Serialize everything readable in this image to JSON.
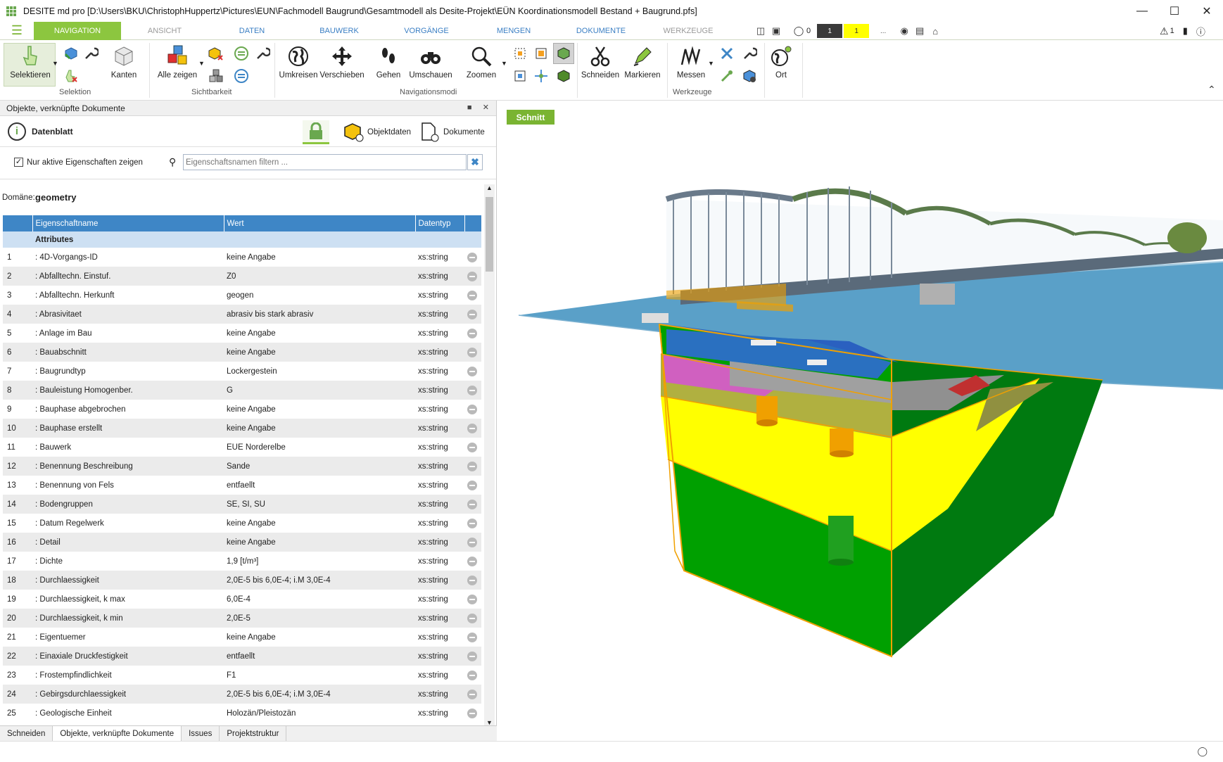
{
  "window": {
    "title": "DESITE md pro [D:\\Users\\BKU\\ChristophHuppertz\\Pictures\\EUN\\Fachmodell Baugrund\\Gesamtmodell als Desite-Projekt\\EÜN Koordinationsmodell Bestand + Baugrund.pfs]"
  },
  "menu": {
    "tabs": [
      "NAVIGATION",
      "ANSICHT",
      "DATEN",
      "BAUWERK",
      "VORGÄNGE",
      "MENGEN",
      "DOKUMENTE",
      "WERKZEUGE"
    ],
    "counter_a": "0",
    "counter_b": "1",
    "counter_c": "1",
    "ellipsis": "...",
    "warning_count": "1"
  },
  "ribbon": {
    "selektieren": "Selektieren",
    "kanten": "Kanten",
    "alle_zeigen": "Alle zeigen",
    "umkreisen": "Umkreisen",
    "verschieben": "Verschieben",
    "gehen": "Gehen",
    "umschauen": "Umschauen",
    "zoomen": "Zoomen",
    "schneiden": "Schneiden",
    "markieren": "Markieren",
    "messen": "Messen",
    "ort": "Ort",
    "group_selektion": "Selektion",
    "group_sichtbarkeit": "Sichtbarkeit",
    "group_navigationsmodi": "Navigationsmodi",
    "group_werkzeuge": "Werkzeuge"
  },
  "panel": {
    "title": "Objekte, verknüpfte Dokumente",
    "datenblatt": "Datenblatt",
    "objektdaten": "Objektdaten",
    "dokumente": "Dokumente",
    "checkbox_label": "Nur aktive Eigenschaften zeigen",
    "filter_placeholder": "Eigenschaftsnamen filtern ...",
    "domain_label": "Domäne:",
    "domain_value": "geometry",
    "columns": [
      "Eigenschaftname",
      "Wert",
      "Datentyp"
    ],
    "group_name": "Attributes",
    "rows": [
      {
        "n": "1",
        "name": ": 4D-Vorgangs-ID",
        "value": "keine Angabe",
        "type": "xs:string"
      },
      {
        "n": "2",
        "name": ": Abfalltechn. Einstuf.",
        "value": "Z0",
        "type": "xs:string"
      },
      {
        "n": "3",
        "name": ": Abfalltechn. Herkunft",
        "value": "geogen",
        "type": "xs:string"
      },
      {
        "n": "4",
        "name": ": Abrasivitaet",
        "value": "abrasiv bis stark abrasiv",
        "type": "xs:string"
      },
      {
        "n": "5",
        "name": ": Anlage im Bau",
        "value": "keine Angabe",
        "type": "xs:string"
      },
      {
        "n": "6",
        "name": ": Bauabschnitt",
        "value": "keine Angabe",
        "type": "xs:string"
      },
      {
        "n": "7",
        "name": ": Baugrundtyp",
        "value": "Lockergestein",
        "type": "xs:string"
      },
      {
        "n": "8",
        "name": ": Bauleistung Homogenber.",
        "value": "G",
        "type": "xs:string"
      },
      {
        "n": "9",
        "name": ": Bauphase abgebrochen",
        "value": "keine Angabe",
        "type": "xs:string"
      },
      {
        "n": "10",
        "name": ": Bauphase erstellt",
        "value": "keine Angabe",
        "type": "xs:string"
      },
      {
        "n": "11",
        "name": ": Bauwerk",
        "value": "EUE Norderelbe",
        "type": "xs:string"
      },
      {
        "n": "12",
        "name": ": Benennung Beschreibung",
        "value": "Sande",
        "type": "xs:string"
      },
      {
        "n": "13",
        "name": ": Benennung von Fels",
        "value": "entfaellt",
        "type": "xs:string"
      },
      {
        "n": "14",
        "name": ": Bodengruppen",
        "value": "SE, SI, SU",
        "type": "xs:string"
      },
      {
        "n": "15",
        "name": ": Datum Regelwerk",
        "value": "keine Angabe",
        "type": "xs:string"
      },
      {
        "n": "16",
        "name": ": Detail",
        "value": "keine Angabe",
        "type": "xs:string"
      },
      {
        "n": "17",
        "name": ": Dichte",
        "value": "1,9 [t/m³]",
        "type": "xs:string"
      },
      {
        "n": "18",
        "name": ": Durchlaessigkeit",
        "value": "2,0E-5 bis 6,0E-4; i.M 3,0E-4",
        "type": "xs:string"
      },
      {
        "n": "19",
        "name": ": Durchlaessigkeit, k max",
        "value": "6,0E-4",
        "type": "xs:string"
      },
      {
        "n": "20",
        "name": ": Durchlaessigkeit, k min",
        "value": "2,0E-5",
        "type": "xs:string"
      },
      {
        "n": "21",
        "name": ": Eigentuemer",
        "value": "keine Angabe",
        "type": "xs:string"
      },
      {
        "n": "22",
        "name": ": Einaxiale Druckfestigkeit",
        "value": "entfaellt",
        "type": "xs:string"
      },
      {
        "n": "23",
        "name": ": Frostempfindlichkeit",
        "value": "F1",
        "type": "xs:string"
      },
      {
        "n": "24",
        "name": ": Gebirgsdurchlaessigkeit",
        "value": "2,0E-5 bis 6,0E-4; i.M 3,0E-4",
        "type": "xs:string"
      },
      {
        "n": "25",
        "name": ": Geologische Einheit",
        "value": "Holozän/Pleistozän",
        "type": "xs:string"
      }
    ],
    "bottom_tabs": [
      "Schneiden",
      "Objekte, verknüpfte Dokumente",
      "Issues",
      "Projektstruktur"
    ]
  },
  "viewport": {
    "schnitt_label": "Schnitt"
  }
}
